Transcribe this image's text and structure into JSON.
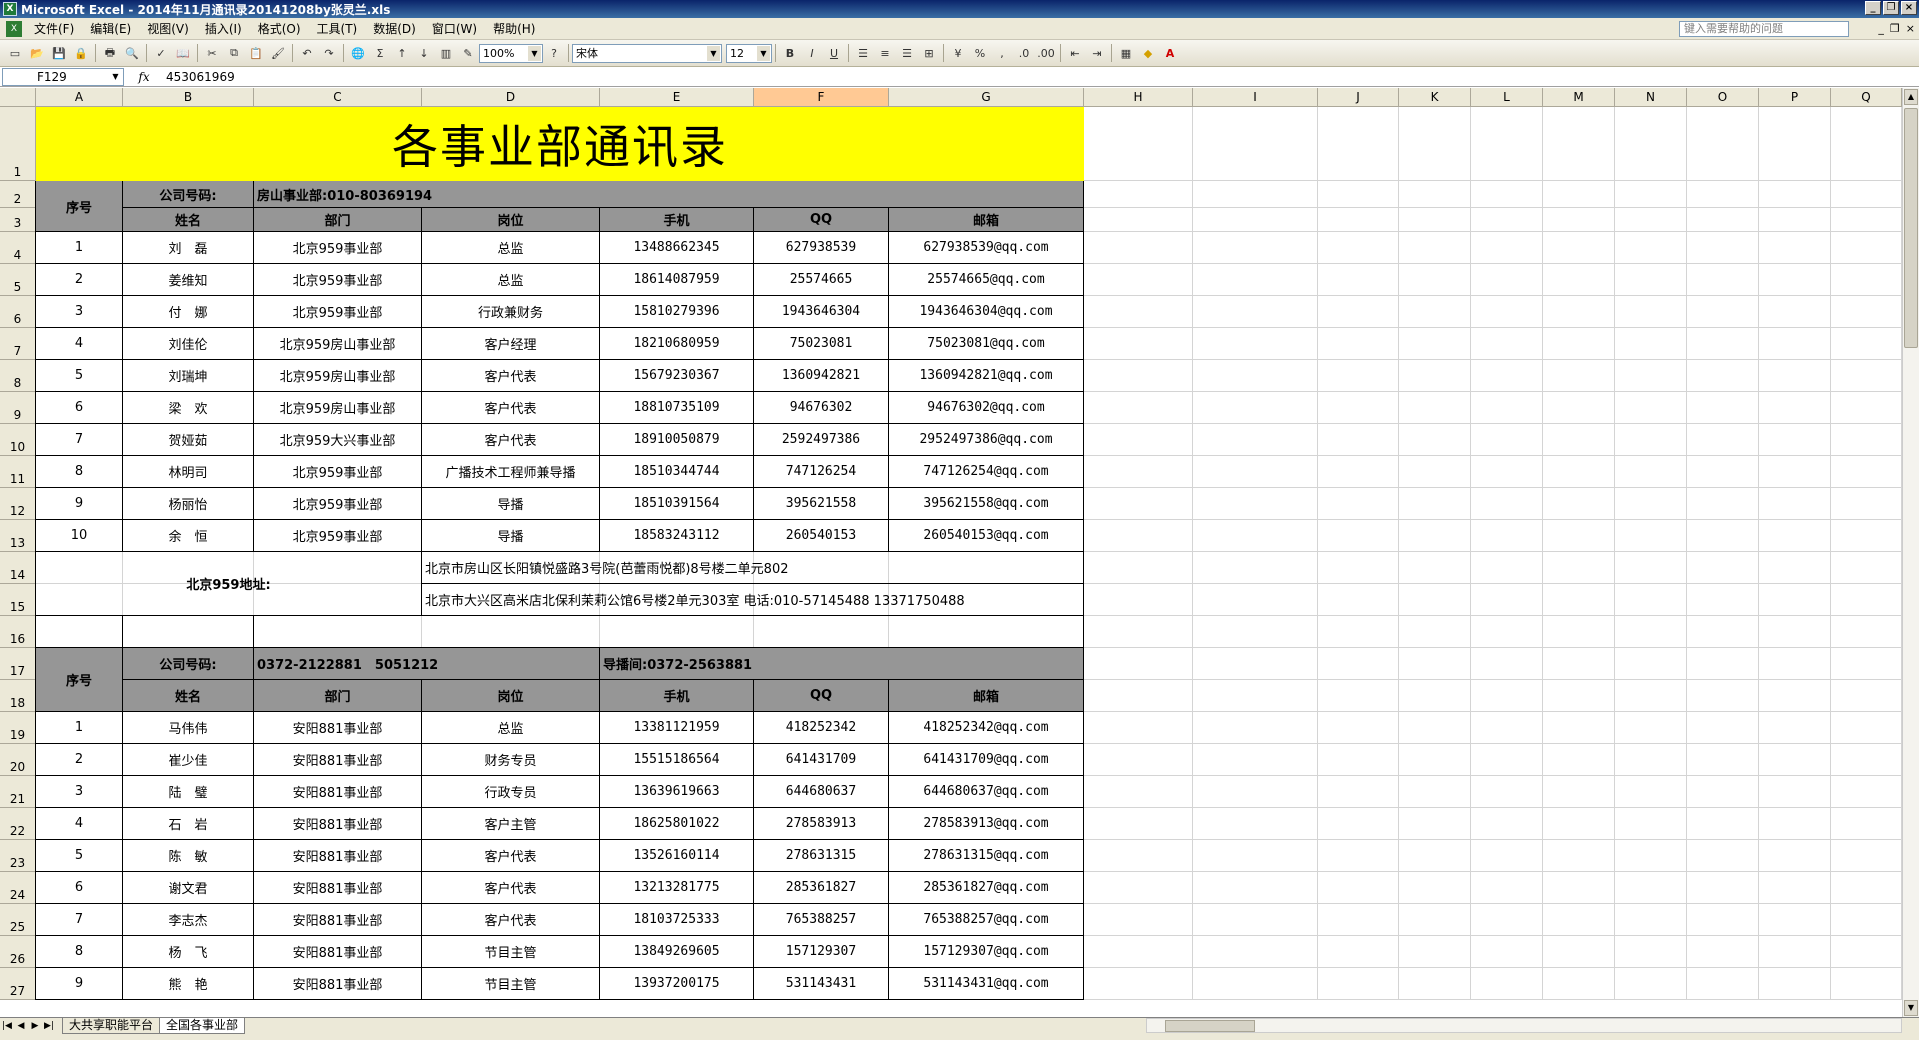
{
  "window": {
    "title": "Microsoft Excel - 2014年11月通讯录20141208by张灵兰.xls",
    "controls": [
      "_",
      "❐",
      "×"
    ]
  },
  "menu": {
    "items": [
      "文件(F)",
      "编辑(E)",
      "视图(V)",
      "插入(I)",
      "格式(O)",
      "工具(T)",
      "数据(D)",
      "窗口(W)",
      "帮助(H)"
    ],
    "help_placeholder": "键入需要帮助的问题"
  },
  "toolbar": {
    "zoom": "100%",
    "font": "宋体",
    "font_size": "12"
  },
  "formula_bar": {
    "name_box": "F129",
    "fx": "fx",
    "value": "453061969"
  },
  "columns": [
    "A",
    "B",
    "C",
    "D",
    "E",
    "F",
    "G",
    "H",
    "I",
    "J",
    "K",
    "L",
    "M",
    "N",
    "O",
    "P",
    "Q"
  ],
  "rows": [
    "1",
    "2",
    "3",
    "4",
    "5",
    "6",
    "7",
    "8",
    "9",
    "10",
    "11",
    "12",
    "13",
    "14",
    "15",
    "16",
    "17",
    "18",
    "19",
    "20",
    "21",
    "22",
    "23",
    "24",
    "25",
    "26",
    "27"
  ],
  "sheet": {
    "title": "各事业部通讯录",
    "section1": {
      "seq_label": "序号",
      "company_label": "公司号码:",
      "company_value": "房山事业部:010-80369194",
      "headers": [
        "姓名",
        "部门",
        "岗位",
        "手机",
        "QQ",
        "邮箱"
      ],
      "rows": [
        [
          "1",
          "刘　磊",
          "北京959事业部",
          "总监",
          "13488662345",
          "627938539",
          "627938539@qq.com"
        ],
        [
          "2",
          "姜维知",
          "北京959事业部",
          "总监",
          "18614087959",
          "25574665",
          "25574665@qq.com"
        ],
        [
          "3",
          "付　娜",
          "北京959事业部",
          "行政兼财务",
          "15810279396",
          "1943646304",
          "1943646304@qq.com"
        ],
        [
          "4",
          "刘佳伦",
          "北京959房山事业部",
          "客户经理",
          "18210680959",
          "75023081",
          "75023081@qq.com"
        ],
        [
          "5",
          "刘瑞坤",
          "北京959房山事业部",
          "客户代表",
          "15679230367",
          "1360942821",
          "1360942821@qq.com"
        ],
        [
          "6",
          "梁　欢",
          "北京959房山事业部",
          "客户代表",
          "18810735109",
          "94676302",
          "94676302@qq.com"
        ],
        [
          "7",
          "贺娅茹",
          "北京959大兴事业部",
          "客户代表",
          "18910050879",
          "2592497386",
          "2952497386@qq.com"
        ],
        [
          "8",
          "林明司",
          "北京959事业部",
          "广播技术工程师兼导播",
          "18510344744",
          "747126254",
          "747126254@qq.com"
        ],
        [
          "9",
          "杨丽怡",
          "北京959事业部",
          "导播",
          "18510391564",
          "395621558",
          "395621558@qq.com"
        ],
        [
          "10",
          "余　恒",
          "北京959事业部",
          "导播",
          "18583243112",
          "260540153",
          "260540153@qq.com"
        ]
      ],
      "address_label": "北京959地址:",
      "address1": "北京市房山区长阳镇悦盛路3号院(芭蕾雨悦都)8号楼二单元802",
      "address2": "北京市大兴区高米店北保利茉莉公馆6号楼2单元303室 电话:010-57145488 13371750488"
    },
    "section2": {
      "seq_label": "序号",
      "company_label": "公司号码:",
      "company_value": "0372-2122881　5051212",
      "studio_value": "导播间:0372-2563881",
      "headers": [
        "姓名",
        "部门",
        "岗位",
        "手机",
        "QQ",
        "邮箱"
      ],
      "rows": [
        [
          "1",
          "马伟伟",
          "安阳881事业部",
          "总监",
          "13381121959",
          "418252342",
          "418252342@qq.com"
        ],
        [
          "2",
          "崔少佳",
          "安阳881事业部",
          "财务专员",
          "15515186564",
          "641431709",
          "641431709@qq.com"
        ],
        [
          "3",
          "陆　璧",
          "安阳881事业部",
          "行政专员",
          "13639619663",
          "644680637",
          "644680637@qq.com"
        ],
        [
          "4",
          "石　岩",
          "安阳881事业部",
          "客户主管",
          "18625801022",
          "278583913",
          "278583913@qq.com"
        ],
        [
          "5",
          "陈　敏",
          "安阳881事业部",
          "客户代表",
          "13526160114",
          "278631315",
          "278631315@qq.com"
        ],
        [
          "6",
          "谢文君",
          "安阳881事业部",
          "客户代表",
          "13213281775",
          "285361827",
          "285361827@qq.com"
        ],
        [
          "7",
          "李志杰",
          "安阳881事业部",
          "客户代表",
          "18103725333",
          "765388257",
          "765388257@qq.com"
        ],
        [
          "8",
          "杨　飞",
          "安阳881事业部",
          "节目主管",
          "13849269605",
          "157129307",
          "157129307@qq.com"
        ],
        [
          "9",
          "熊　艳",
          "安阳881事业部",
          "节目主管",
          "13937200175",
          "531143431",
          "531143431@qq.com"
        ]
      ]
    }
  },
  "tabs": [
    "大共享职能平台",
    "全国各事业部"
  ],
  "colors": {
    "title_fill": "#ffff00",
    "header_fill": "#969696",
    "selected_header": "#ffc994"
  }
}
